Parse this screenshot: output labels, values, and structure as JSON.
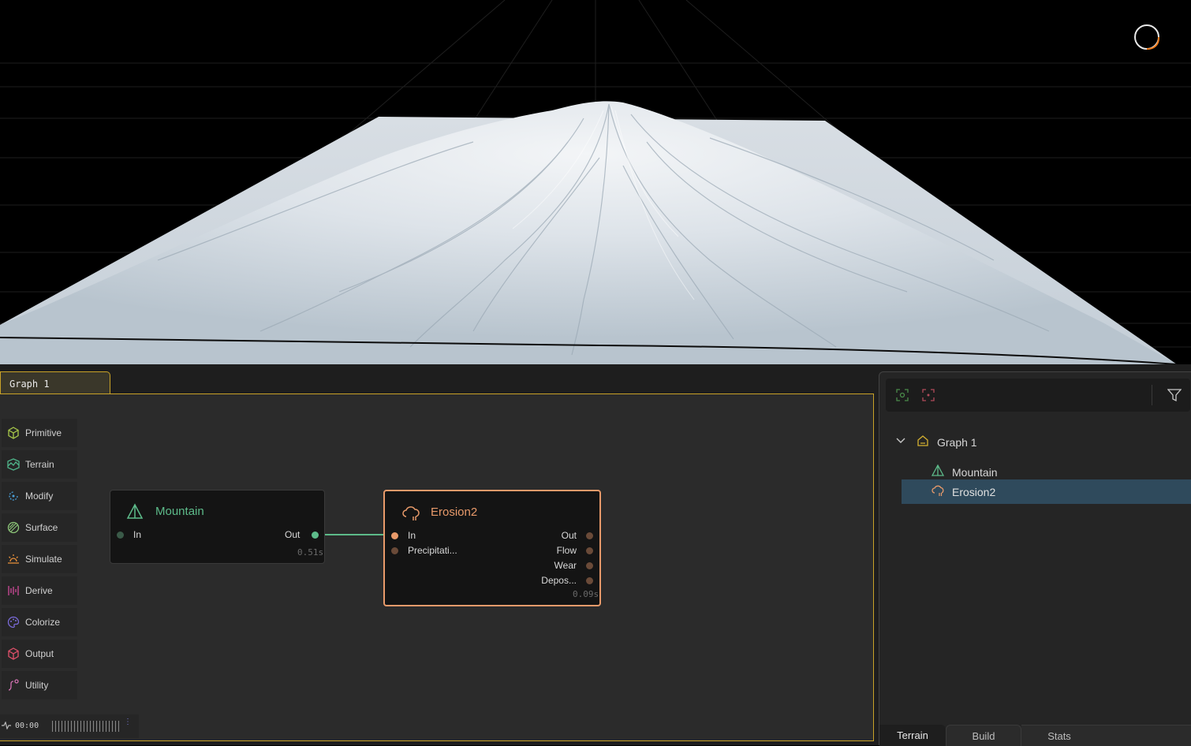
{
  "graph_tab": {
    "label": "Graph 1"
  },
  "categories": [
    {
      "label": "Primitive",
      "icon": "cube-icon",
      "color": "#a8c84a"
    },
    {
      "label": "Terrain",
      "icon": "terrain-icon",
      "color": "#4fb58a"
    },
    {
      "label": "Modify",
      "icon": "modify-icon",
      "color": "#4aa0d8"
    },
    {
      "label": "Surface",
      "icon": "surface-icon",
      "color": "#8ec87a"
    },
    {
      "label": "Simulate",
      "icon": "simulate-icon",
      "color": "#e8903a"
    },
    {
      "label": "Derive",
      "icon": "derive-icon",
      "color": "#d04a9a"
    },
    {
      "label": "Colorize",
      "icon": "palette-icon",
      "color": "#7a6ad8"
    },
    {
      "label": "Output",
      "icon": "output-cube-icon",
      "color": "#e0506a"
    },
    {
      "label": "Utility",
      "icon": "utility-icon",
      "color": "#d070b0"
    }
  ],
  "nodes": {
    "mountain": {
      "title": "Mountain",
      "inputs": [
        "In"
      ],
      "outputs": [
        "Out"
      ],
      "time": "0.51s",
      "color": "#5dbb8a"
    },
    "erosion": {
      "title": "Erosion2",
      "inputs": [
        "In",
        "Precipitati..."
      ],
      "outputs": [
        "Out",
        "Flow",
        "Wear",
        "Depos..."
      ],
      "time": "0.09s",
      "color": "#e89a6a"
    }
  },
  "timeline": {
    "time": "00:00"
  },
  "tree": {
    "root": "Graph 1",
    "items": [
      "Mountain",
      "Erosion2"
    ],
    "selected": "Erosion2"
  },
  "right_tabs": [
    "Terrain",
    "Build",
    "Stats"
  ],
  "active_right_tab": "Terrain"
}
